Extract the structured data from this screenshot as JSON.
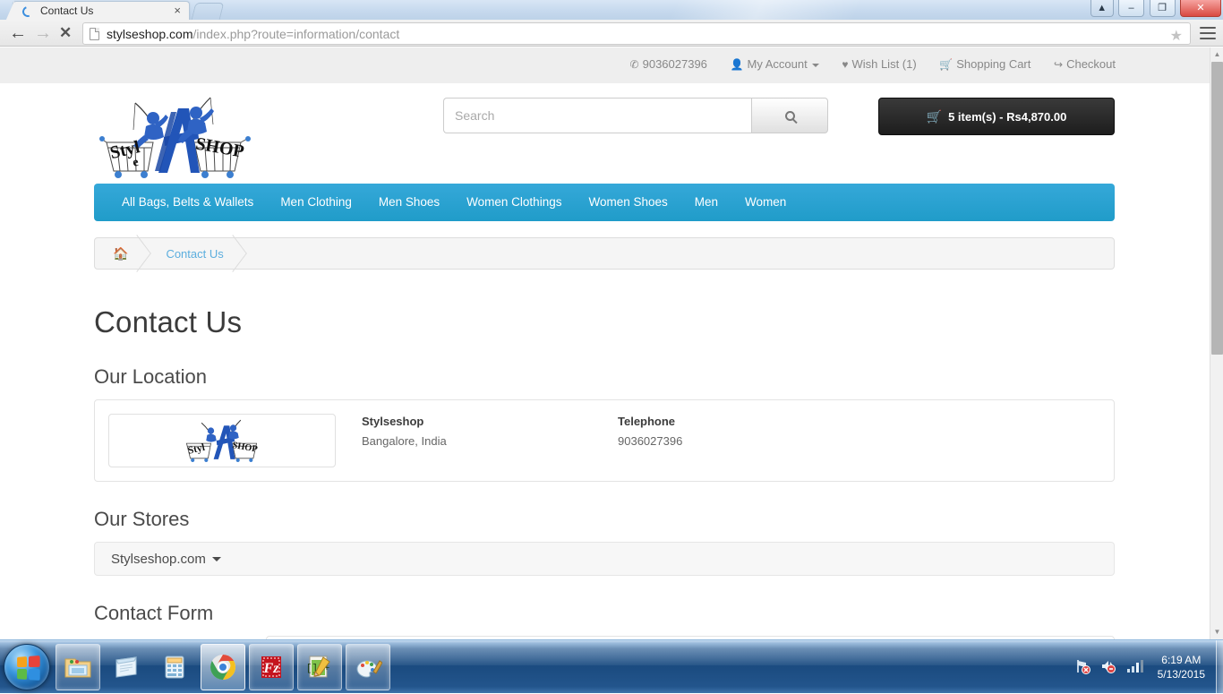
{
  "browser": {
    "tab_title": "Contact Us",
    "tab_close": "×",
    "url_host": "stylseshop.com",
    "url_path": "/index.php?route=information/contact",
    "back_icon": "←",
    "forward_icon": "→",
    "stop_icon": "✕",
    "star_icon": "★",
    "minimize_label": "–",
    "restore_label": "❐",
    "close_label": "✕",
    "extra_label": "▲"
  },
  "topbar": {
    "links": [
      {
        "icon": "✆",
        "label": "9036027396",
        "caret": false
      },
      {
        "icon": "👤",
        "label": "My Account",
        "caret": true
      },
      {
        "icon": "♥",
        "label": "Wish List (1)",
        "caret": false
      },
      {
        "icon": "🛒",
        "label": "Shopping Cart",
        "caret": false
      },
      {
        "icon": "↪",
        "label": "Checkout",
        "caret": false
      }
    ]
  },
  "header": {
    "logo_alt": "Stylseshop logo",
    "search_placeholder": "Search",
    "search_value": "",
    "search_icon": "search-icon",
    "cart_icon": "🛒",
    "cart_label": "5 item(s) - Rs4,870.00"
  },
  "nav": {
    "items": [
      "All Bags, Belts & Wallets",
      "Men Clothing",
      "Men Shoes",
      "Women Clothings",
      "Women Shoes",
      "Men",
      "Women"
    ]
  },
  "breadcrumb": {
    "home_icon": "🏠",
    "items": [
      "Contact Us"
    ]
  },
  "main": {
    "page_title": "Contact Us",
    "location": {
      "heading": "Our Location",
      "store_name_label": "Stylseshop",
      "address": "Bangalore, India",
      "telephone_label": "Telephone",
      "telephone": "9036027396"
    },
    "stores": {
      "heading": "Our Stores",
      "selected": "Stylseshop.com"
    },
    "contact_form": {
      "heading": "Contact Form"
    }
  },
  "colors": {
    "nav_blue": "#219cc9",
    "link_blue": "#5caede",
    "cart_dark": "#1d1d1d",
    "taskbar_blue": "#1b4b80"
  },
  "taskbar": {
    "start_label": "Start",
    "items": [
      {
        "name": "windows-explorer",
        "state": "open"
      },
      {
        "name": "notepad",
        "state": "pinned"
      },
      {
        "name": "calculator",
        "state": "pinned"
      },
      {
        "name": "google-chrome",
        "state": "active"
      },
      {
        "name": "filezilla",
        "state": "open"
      },
      {
        "name": "notepad-plus-plus",
        "state": "open"
      },
      {
        "name": "paint",
        "state": "open"
      }
    ],
    "tray": {
      "network_icon": "network-error-icon",
      "volume_icon": "volume-muted-icon",
      "signal_icon": "signal-bars-icon",
      "time": "6:19 AM",
      "date": "5/13/2015"
    }
  }
}
